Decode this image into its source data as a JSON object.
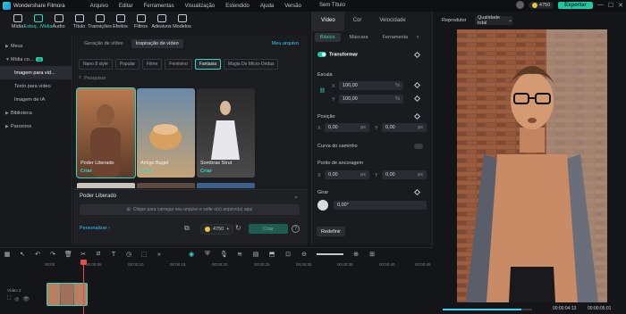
{
  "app": {
    "name": "Wondershare Filmora",
    "doc_title": "Sem Título"
  },
  "menu": [
    "Arquivo",
    "Editar",
    "Ferramentas",
    "Visualização",
    "Estendido",
    "Ajuda",
    "Versão"
  ],
  "account": {
    "credits": "4750",
    "export_label": "Exportar"
  },
  "toolbar": [
    "Mídia",
    "Estoq...Mídia",
    "Áudio",
    "Título",
    "Transições",
    "Efeitos",
    "Filtros",
    "Adesivos",
    "Modelos"
  ],
  "sidebar": {
    "items": [
      {
        "label": "Meus",
        "type": "group"
      },
      {
        "label": "Mídia co...",
        "type": "group",
        "badge": "AI"
      },
      {
        "label": "Imagem para vid...",
        "type": "item",
        "active": true
      },
      {
        "label": "Texto para vídeo",
        "type": "item"
      },
      {
        "label": "Imagem de IA",
        "type": "item"
      },
      {
        "label": "Biblioteca",
        "type": "group"
      },
      {
        "label": "Parceiros",
        "type": "group"
      }
    ]
  },
  "content": {
    "tabs": [
      {
        "label": "Geração de vídeo"
      },
      {
        "label": "Inspiração de vídeo",
        "active": true
      }
    ],
    "my_works": "Meu arquivo",
    "chips": [
      "Nano 8 style",
      "Popular",
      "Filme",
      "Feminino",
      "Fantasia",
      "Magia De Micro-Ondas"
    ],
    "active_chip": "Fantasia",
    "search_placeholder": "Pesquisar",
    "cards": [
      {
        "label": "Poder Liberado",
        "cta": "Criar",
        "selected": true
      },
      {
        "label": "Amigo Bagel",
        "cta": "Criar"
      },
      {
        "label": "Sombras Strut",
        "cta": "Criar"
      }
    ],
    "bottom": {
      "title": "Poder Liberado",
      "upload_hint": "Clique para carregar seu arquivo e solte o(s) arquivo(s) aqui",
      "personalize": "Personalizar",
      "credit": "4750",
      "create": "Criar"
    }
  },
  "properties": {
    "tabs": [
      "Vídeo",
      "Cor",
      "Velocidade"
    ],
    "subtabs": [
      "Básico",
      "Máscara",
      "Ferramenta"
    ],
    "transform_label": "Transformar",
    "scale_label": "Escala",
    "scale_x": "100,00",
    "scale_y": "100,00",
    "scale_unit": "%",
    "position_label": "Posição",
    "pos_x": "0,00",
    "pos_y": "0,00",
    "px_unit": "px",
    "path_curve_label": "Curva do caminho",
    "anchor_label": "Ponto de ancoragem",
    "anchor_x": "0,00",
    "anchor_y": "0,00",
    "rotate_label": "Girar",
    "rotate_value": "0,00°",
    "reset_label": "Redefinir",
    "x": "X",
    "y": "Y"
  },
  "preview": {
    "label": "Reprodutor",
    "quality": "Qualidade total",
    "time_current": "00:00:04:13",
    "time_total": "00:00:05:01",
    "progress": 0.88
  },
  "timeline": {
    "ticks": [
      "00:00",
      "00:00:05",
      "00:00:10",
      "00:00:15",
      "00:00:20",
      "00:00:25",
      "00:00:30",
      "00:00:35",
      "00:00:40",
      "00:00:45"
    ],
    "track_label": "Vídeo 2"
  }
}
